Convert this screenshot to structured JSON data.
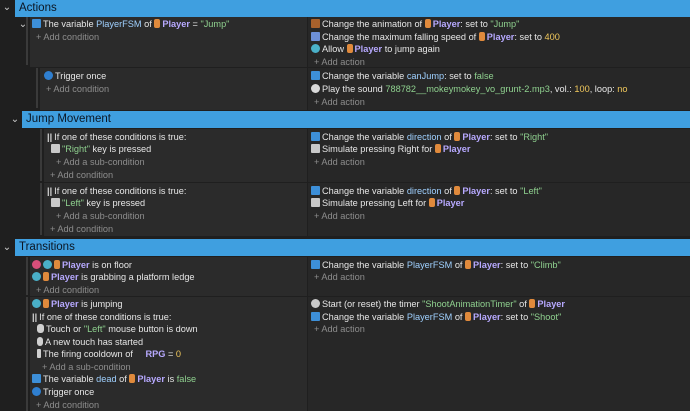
{
  "sections": {
    "actions": {
      "title": "Actions"
    },
    "jump_movement": {
      "title": "Jump Movement"
    },
    "transitions": {
      "title": "Transitions"
    }
  },
  "events": {
    "e1": {
      "cond1": {
        "prefix": "The variable",
        "var": "PlayerFSM",
        "of": "of",
        "obj": "Player",
        "op": "=",
        "val": "\"Jump\""
      },
      "add_condition": "+ Add condition",
      "act1": {
        "text": "Change the animation of",
        "obj": "Player",
        "mid": ": set to",
        "val": "\"Jump\""
      },
      "act2": {
        "text": "Change the maximum falling speed of",
        "obj": "Player",
        "mid": ": set to",
        "val": "400"
      },
      "act3": {
        "text": "Allow",
        "obj": "Player",
        "tail": "to jump again"
      },
      "add_action": "+ Add action"
    },
    "e2": {
      "cond1": {
        "text": "Trigger once"
      },
      "add_condition": "+ Add condition",
      "act1": {
        "text": "Change the variable",
        "var": "canJump",
        "mid": ": set to",
        "val": "false"
      },
      "act2": {
        "text": "Play the sound",
        "file": "788782__mokeymokey_vo_grunt-2.mp3",
        "vol_label": ", vol.:",
        "vol": "100",
        "loop_label": ", loop:",
        "loop": "no"
      },
      "add_action": "+ Add action"
    },
    "e3": {
      "cond1": {
        "text": "If one of these conditions is true:"
      },
      "cond2": {
        "key": "\"Right\"",
        "tail": "key is pressed"
      },
      "add_sub": "+ Add a sub-condition",
      "add_condition": "+ Add condition",
      "act1": {
        "text": "Change the variable",
        "var": "direction",
        "of": "of",
        "obj": "Player",
        "mid": ": set to",
        "val": "\"Right\""
      },
      "act2": {
        "text": "Simulate pressing Right for",
        "obj": "Player"
      },
      "add_action": "+ Add action"
    },
    "e4": {
      "cond1": {
        "text": "If one of these conditions is true:"
      },
      "cond2": {
        "key": "\"Left\"",
        "tail": "key is pressed"
      },
      "add_sub": "+ Add a sub-condition",
      "add_condition": "+ Add condition",
      "act1": {
        "text": "Change the variable",
        "var": "direction",
        "of": "of",
        "obj": "Player",
        "mid": ": set to",
        "val": "\"Left\""
      },
      "act2": {
        "text": "Simulate pressing Left for",
        "obj": "Player"
      },
      "add_action": "+ Add action"
    },
    "e5": {
      "cond1": {
        "obj": "Player",
        "tail": "is on floor"
      },
      "cond2": {
        "obj": "Player",
        "tail": "is grabbing a platform ledge"
      },
      "add_condition": "+ Add condition",
      "act1": {
        "text": "Change the variable",
        "var": "PlayerFSM",
        "of": "of",
        "obj": "Player",
        "mid": ": set to",
        "val": "\"Climb\""
      },
      "add_action": "+ Add action"
    },
    "e6": {
      "cond1": {
        "obj": "Player",
        "tail": "is jumping"
      },
      "cond2": {
        "text": "If one of these conditions is true:"
      },
      "cond3": {
        "pre": "Touch or",
        "key": "\"Left\"",
        "tail": "mouse button is down"
      },
      "cond4": {
        "text": "A new touch has started"
      },
      "cond5": {
        "pre": "The firing cooldown of",
        "obj": "RPG",
        "op": "=",
        "val": "0"
      },
      "add_sub": "+ Add a sub-condition",
      "cond6": {
        "prefix": "The variable",
        "var": "dead",
        "of": "of",
        "obj": "Player",
        "tail": "is",
        "val": "false"
      },
      "cond7": {
        "text": "Trigger once"
      },
      "add_condition": "+ Add condition",
      "act1": {
        "text": "Start (or reset) the timer",
        "val": "\"ShootAnimationTimer\"",
        "of": "of",
        "obj": "Player"
      },
      "act2": {
        "text": "Change the variable",
        "var": "PlayerFSM",
        "of": "of",
        "obj": "Player",
        "mid": ": set to",
        "val": "\"Shoot\""
      },
      "add_action": "+ Add action"
    }
  },
  "colors": {
    "header": "#3f9fe0",
    "object": "#b7a9ff",
    "string": "#8fd18f",
    "number": "#f0c85c"
  }
}
